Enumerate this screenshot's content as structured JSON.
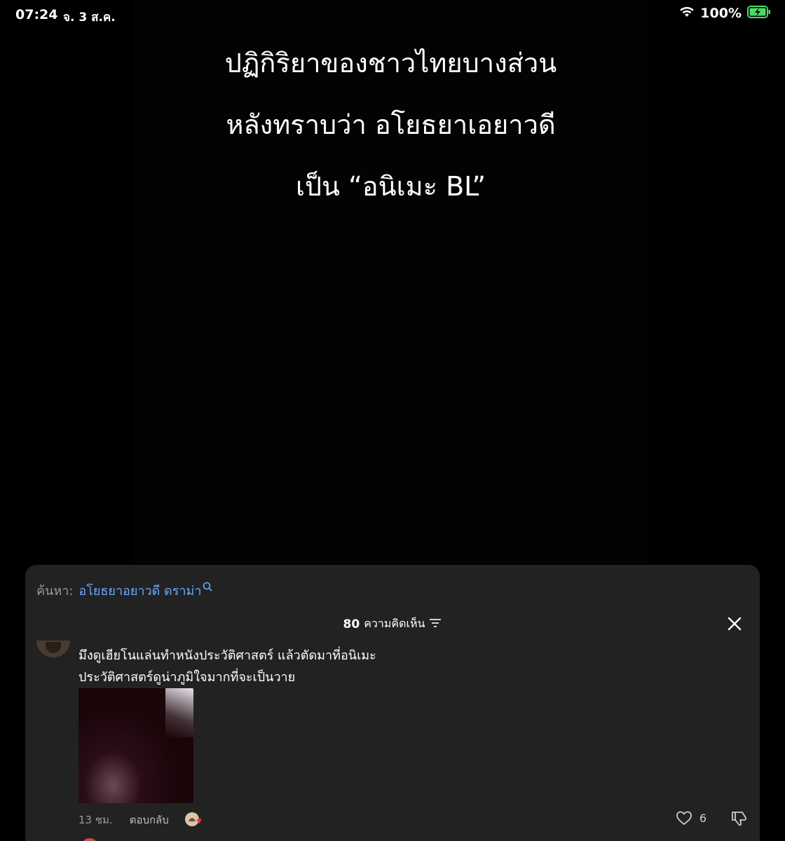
{
  "status_bar": {
    "time": "07:24",
    "date": "จ. 3 ส.ค.",
    "battery": "100%",
    "battery_color": "#4cd964"
  },
  "video": {
    "caption_lines": [
      "ปฏิกิริยาของชาวไทยบางส่วน",
      "หลังทราบว่า อโยธยาเอยาวดี",
      "เป็น “อนิเมะ BL”"
    ]
  },
  "sheet": {
    "search_prefix": "ค้นหา:",
    "search_query": "อโยธยาอยาวดี ดราม่า",
    "comments_count": "80",
    "comments_label": "ความคิดเห็น",
    "comment": {
      "lines": [
        "มึงดูเฮียโนแล่นทำหนังประวัติศาสตร์ แล้วตัดมาที่อนิเมะ",
        "ประวัติศาสตร์ดูน่าภูมิใจมากที่จะเป็นวาย"
      ],
      "time": "13 ชม.",
      "reply_label": "ตอบกลับ",
      "likes": "6"
    }
  },
  "icons": {
    "wifi": "wifi-icon",
    "battery": "battery-charging-icon",
    "search": "search-icon",
    "sort": "sort-icon",
    "close": "close-icon",
    "heart": "heart-icon",
    "dislike": "thumbs-down-icon"
  }
}
